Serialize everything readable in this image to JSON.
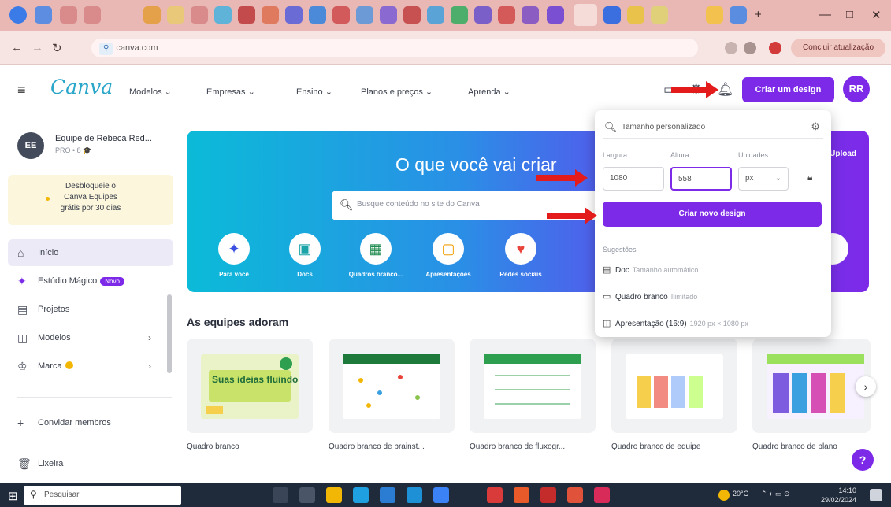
{
  "browser": {
    "url": "canva.com",
    "finish_update_label": "Concluir atualização",
    "window_minimize": "—",
    "window_maximize": "□",
    "window_close": "✕"
  },
  "header": {
    "logo": "Canva",
    "nav": [
      "Modelos ⌄",
      "Empresas ⌄",
      "Ensino ⌄",
      "Planos e preços ⌄",
      "Aprenda ⌄"
    ],
    "create_button": "Criar um design",
    "avatar_initials": "RR"
  },
  "sidebar": {
    "team_initials": "EE",
    "team_name": "Equipe de Rebeca Red...",
    "team_sub": "PRO • 8 🎓",
    "promo_lines": [
      "Desbloqueie o",
      "Canva Equipes",
      "grátis por 30 dias"
    ],
    "items": [
      {
        "icon": "⌂",
        "label": "Início"
      },
      {
        "icon": "✦",
        "label": "Estúdio Mágico",
        "badge": "Novo"
      },
      {
        "icon": "▤",
        "label": "Projetos"
      },
      {
        "icon": "◫",
        "label": "Modelos",
        "chev": "›"
      },
      {
        "icon": "♔",
        "label": "Marca",
        "chev": "›"
      }
    ],
    "invite_label": "Convidar membros",
    "trash_label": "Lixeira"
  },
  "hero": {
    "title": "O que você vai criar",
    "search_placeholder": "Busque conteúdo no site do Canva",
    "upload_label": "Upload",
    "categories": [
      {
        "icon": "✦",
        "label": "Para você",
        "color": "#3b4fe0"
      },
      {
        "icon": "▣",
        "label": "Docs",
        "color": "#1aa4a8"
      },
      {
        "icon": "▦",
        "label": "Quadros branco...",
        "color": "#1e8a4d"
      },
      {
        "icon": "▢",
        "label": "Apresentações",
        "color": "#f29f05"
      },
      {
        "icon": "♥",
        "label": "Redes sociais",
        "color": "#e8443a"
      }
    ]
  },
  "teams_section": {
    "title": "As equipes adoram",
    "cards": [
      {
        "label": "Quadro branco",
        "bg": "#eaf3c8",
        "inner_title": "Suas ideias fluindo"
      },
      {
        "label": "Quadro branco de brainst...",
        "bg": "#ffffff"
      },
      {
        "label": "Quadro branco de fluxogr...",
        "bg": "#ffffff"
      },
      {
        "label": "Quadro branco de equipe",
        "bg": "#ffffff"
      },
      {
        "label": "Quadro branco de plano",
        "bg": "#f7f0ff"
      }
    ]
  },
  "popup": {
    "search_text": "Tamanho personalizado",
    "width_label": "Largura",
    "height_label": "Altura",
    "units_label": "Unidades",
    "width_value": "1080",
    "height_value": "558",
    "units_value": "px",
    "create_label": "Criar novo design",
    "suggestions_label": "Sugestões",
    "suggestions": [
      {
        "icon": "▤",
        "label": "Doc",
        "sub": "Tamanho automático"
      },
      {
        "icon": "▭",
        "label": "Quadro branco",
        "sub": "Ilimitado"
      },
      {
        "icon": "◫",
        "label": "Apresentação (16:9)",
        "sub": "1920 px × 1080 px"
      }
    ]
  },
  "taskbar": {
    "search_placeholder": "Pesquisar",
    "weather": "20°C",
    "time": "14:10",
    "date": "29/02/2024"
  },
  "help_label": "?"
}
